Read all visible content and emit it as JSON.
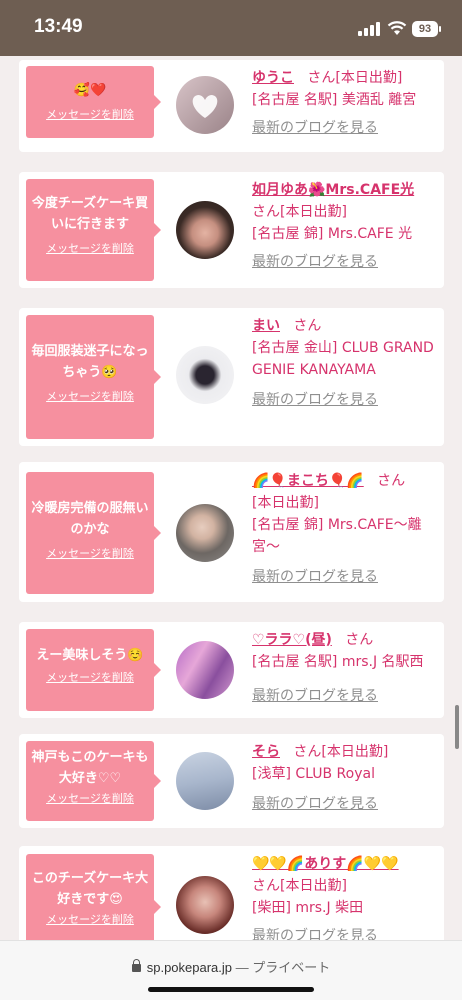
{
  "status": {
    "time": "13:49",
    "battery": "93"
  },
  "browser": {
    "url": "sp.pokepara.jp",
    "private": "— プライベート"
  },
  "labels": {
    "delete": "メッセージを削除",
    "blog": "最新のブログを見る",
    "san": "さん"
  },
  "cards": [
    {
      "message": "🥰❤️",
      "name": "ゆうこ",
      "status": "[本日出勤]",
      "shop": "[名古屋 名駅] 美酒乱 離宮"
    },
    {
      "message": "今度チーズケーキ買いに行きます",
      "name": "如月ゆあ🌺Mrs.CAFE光",
      "status": "[本日出勤]",
      "shop": "[名古屋 錦] Mrs.CAFE 光"
    },
    {
      "message": "毎回服装迷子になっちゃう🥺",
      "name": "まい",
      "status": "",
      "shop": "[名古屋 金山] CLUB GRAND GENIE KANAYAMA"
    },
    {
      "message": "冷暖房完備の服無いのかな",
      "name": "🌈🎈まこち🎈🌈",
      "status": "[本日出勤]",
      "shop": "[名古屋 錦] Mrs.CAFE〜離宮〜"
    },
    {
      "message": "えー美味しそう☺️",
      "name": "♡ララ♡(昼)",
      "status": "",
      "shop": "[名古屋 名駅] mrs.J 名駅西"
    },
    {
      "message": "神戸もこのケーキも大好き♡♡",
      "name": "そら",
      "status": "[本日出勤]",
      "shop": "[浅草] CLUB Royal"
    },
    {
      "message": "このチーズケーキ大好きです😍",
      "name": "💛💛🌈ありす🌈💛💛",
      "status": "[本日出勤]",
      "shop": "[柴田] mrs.J 柴田"
    }
  ]
}
